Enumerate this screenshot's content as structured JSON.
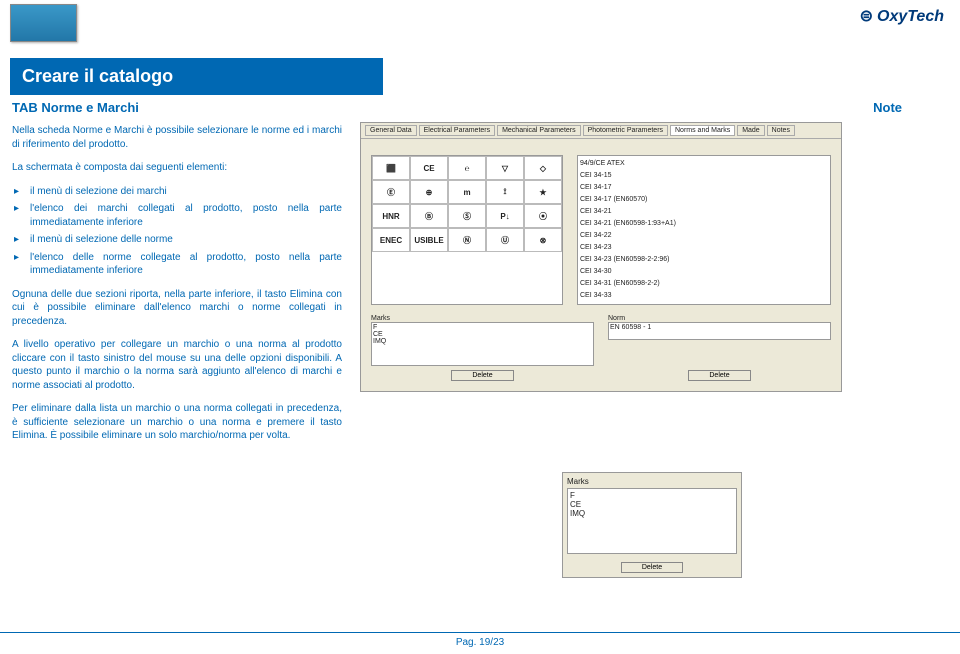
{
  "brand": {
    "glyph": "⊜",
    "name": "OxyTech"
  },
  "page_title": "Creare il catalogo",
  "tab_heading": "TAB Norme e Marchi",
  "note_label": "Note",
  "intro": "Nella scheda Norme e Marchi è possibile selezionare le norme ed i marchi di riferimento del prodotto.",
  "list_intro": "La schermata è composta dai seguenti elementi:",
  "list_items": [
    "il menù di selezione dei marchi",
    "l'elenco dei marchi collegati al prodotto, posto nella parte immediatamente inferiore",
    "il menù di selezione delle norme",
    "l'elenco delle norme collegate al prodotto, posto nella parte immediatamente inferiore"
  ],
  "para2": "Ognuna delle due sezioni riporta, nella parte inferiore, il tasto Elimina con cui è possibile eliminare dall'elenco marchi o norme collegati in precedenza.",
  "para3": "A livello operativo per collegare un marchio o una norma al prodotto cliccare con il tasto sinistro del mouse su una delle opzioni disponibili. A questo punto il marchio o la norma sarà aggiunto all'elenco di marchi e norme associati al prodotto.",
  "para4": "Per eliminare dalla lista un marchio o una norma collegati in precedenza, è sufficiente selezionare un marchio o una norma e premere il tasto Elimina. È possibile eliminare un solo marchio/norma per volta.",
  "main_screenshot": {
    "tabs": [
      "General Data",
      "Electrical Parameters",
      "Mechanical Parameters",
      "Photometric Parameters",
      "Norms and Marks",
      "Made",
      "Notes"
    ],
    "active_tab": 4,
    "mark_grid": [
      [
        "⬛",
        "CE",
        "℮",
        "▽",
        "◇"
      ],
      [
        "Ⓔ",
        "⊕",
        "m",
        "⟟",
        "★"
      ],
      [
        "HNR",
        "Ⓑ",
        "Ⓢ",
        "P↓",
        "⦿"
      ],
      [
        "ENEC",
        "USIBLE",
        "Ⓝ",
        "Ⓤ",
        "⊗"
      ]
    ],
    "norms": [
      "94/9/CE ATEX",
      "CEI 34-15",
      "CEI 34-17",
      "CEI 34-17 (EN60570)",
      "CEI 34-21",
      "CEI 34-21 (EN60598-1:93+A1)",
      "CEI 34-22",
      "CEI 34-23",
      "CEI 34-23 (EN60598-2-2:96)",
      "CEI 34-30",
      "CEI 34-31 (EN60598-2-2)",
      "CEI 34-33"
    ],
    "marks_label": "Marks",
    "marks_values": [
      "F",
      "CE",
      "IMQ"
    ],
    "norm_label": "Norm",
    "norm_value": "EN 60598 - 1",
    "delete_btn_left": "Delete",
    "delete_btn_right": "Delete"
  },
  "small_screenshot": {
    "label": "Marks",
    "values": [
      "F",
      "CE",
      "IMQ"
    ],
    "button": "Delete"
  },
  "footer": "Pag. 19/23"
}
